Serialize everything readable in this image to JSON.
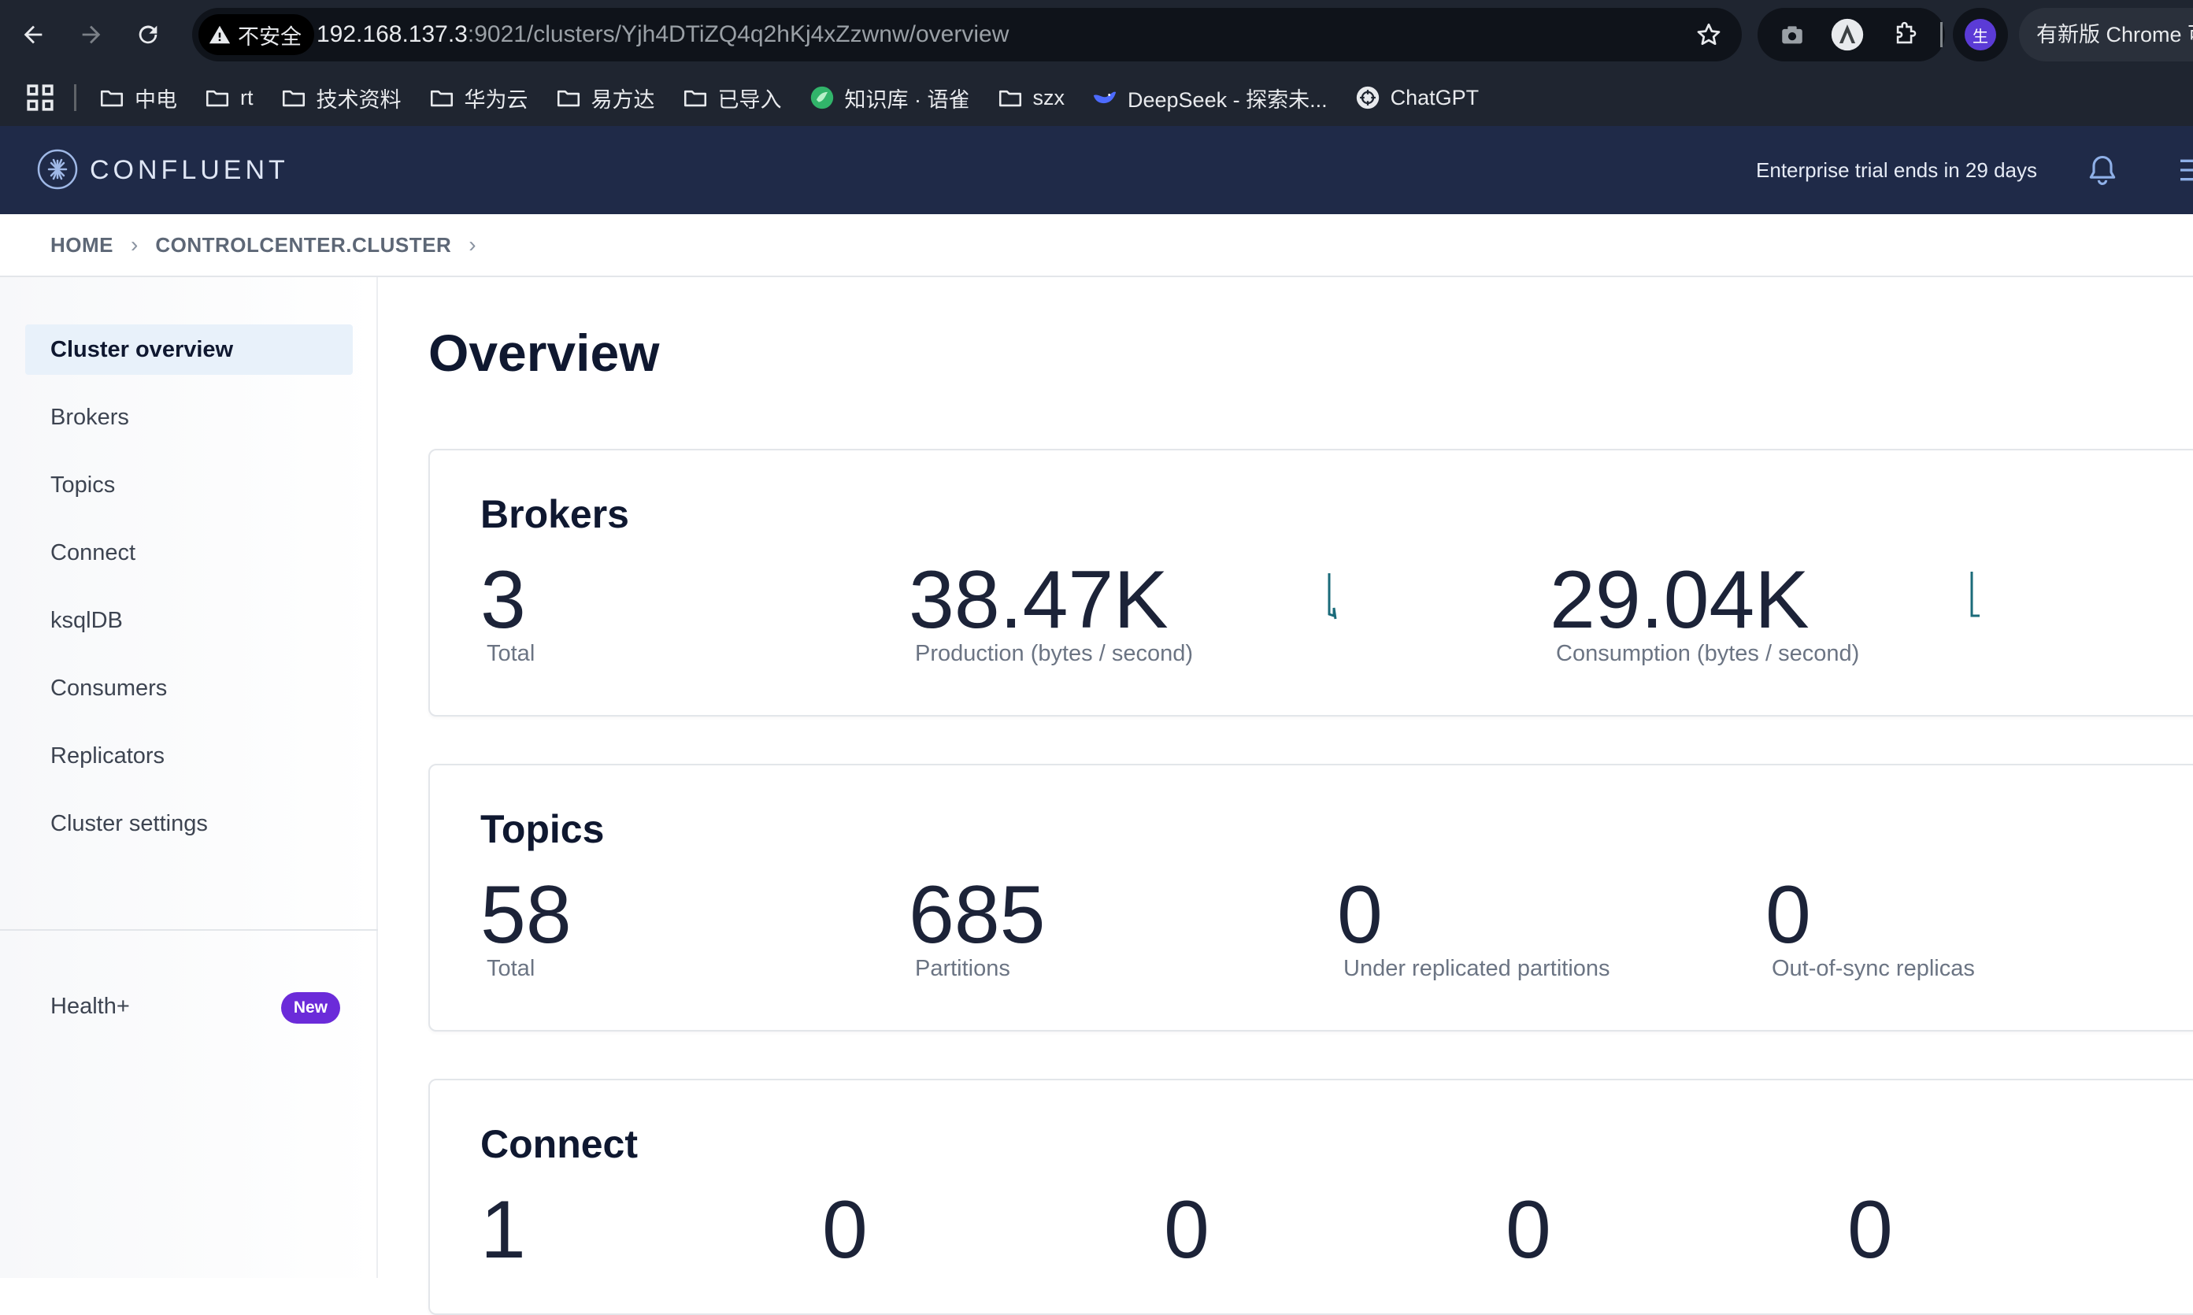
{
  "browser": {
    "insecure_label": "不安全",
    "url_host": "192.168.137.3",
    "url_rest": ":9021/clusters/Yjh4DTiZQ4q2hKj4xZzwnw/overview",
    "profile_initial": "生",
    "update_label": "有新版 Chrome 可",
    "bookmarks": [
      {
        "label": "中电",
        "icon": "folder-icon"
      },
      {
        "label": "rt",
        "icon": "folder-icon"
      },
      {
        "label": "技术资料",
        "icon": "folder-icon"
      },
      {
        "label": "华为云",
        "icon": "folder-icon"
      },
      {
        "label": "易方达",
        "icon": "folder-icon"
      },
      {
        "label": "已导入",
        "icon": "folder-icon"
      },
      {
        "label": "知识库 · 语雀",
        "icon": "yuque-icon"
      },
      {
        "label": "szx",
        "icon": "folder-icon"
      },
      {
        "label": "DeepSeek - 探索未...",
        "icon": "deepseek-icon"
      },
      {
        "label": "ChatGPT",
        "icon": "chatgpt-icon"
      }
    ]
  },
  "header": {
    "logo_text": "CONFLUENT",
    "trial_text": "Enterprise trial ends in 29 days"
  },
  "breadcrumb": {
    "home": "HOME",
    "cluster": "CONTROLCENTER.CLUSTER"
  },
  "sidebar": {
    "items": [
      {
        "label": "Cluster overview",
        "active": true
      },
      {
        "label": "Brokers"
      },
      {
        "label": "Topics"
      },
      {
        "label": "Connect"
      },
      {
        "label": "ksqlDB"
      },
      {
        "label": "Consumers"
      },
      {
        "label": "Replicators"
      },
      {
        "label": "Cluster settings"
      }
    ],
    "health_label": "Health+",
    "health_badge": "New"
  },
  "main": {
    "title": "Overview",
    "brokers": {
      "title": "Brokers",
      "total": "3",
      "total_label": "Total",
      "production": "38.47K",
      "production_label": "Production (bytes / second)",
      "consumption": "29.04K",
      "consumption_label": "Consumption (bytes / second)"
    },
    "topics": {
      "title": "Topics",
      "total": "58",
      "total_label": "Total",
      "partitions": "685",
      "partitions_label": "Partitions",
      "under_replicated": "0",
      "under_replicated_label": "Under replicated partitions",
      "out_of_sync": "0",
      "out_of_sync_label": "Out-of-sync replicas"
    },
    "connect": {
      "title": "Connect",
      "values": [
        "1",
        "0",
        "0",
        "0",
        "0"
      ]
    }
  },
  "colors": {
    "header_bg": "#1f2a48",
    "accent": "#6b2bd9",
    "sparkline": "#1b6b7a"
  }
}
